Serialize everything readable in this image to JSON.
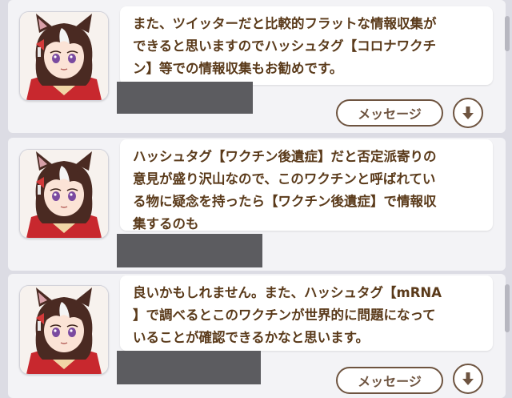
{
  "messages": [
    {
      "text": "また、ツイッターだと比較的フラットな情報収集が\nできると思いますのでハッシュタグ【コロナワクチ\nン】等での情報収集もお勧めです。"
    },
    {
      "text": "ハッシュタグ【ワクチン後遺症】だと否定派寄りの\n意見が盛り沢山なので、このワクチンと呼ばれてい\nる物に疑念を持ったら【ワクチン後遺症】で情報収\n集するのも"
    },
    {
      "text": "良いかもしれません。また、ハッシュタグ【mRNA\n】で調べるとこのワクチンが世界的に問題になって\nいることが確認できるかなと思います。"
    }
  ],
  "buttons": {
    "message_label": "メッセージ"
  },
  "colors": {
    "text": "#5a3a1a",
    "button_border": "#6e5440"
  },
  "icons": {
    "down": "arrow-down-icon",
    "avatar": "character-avatar"
  }
}
